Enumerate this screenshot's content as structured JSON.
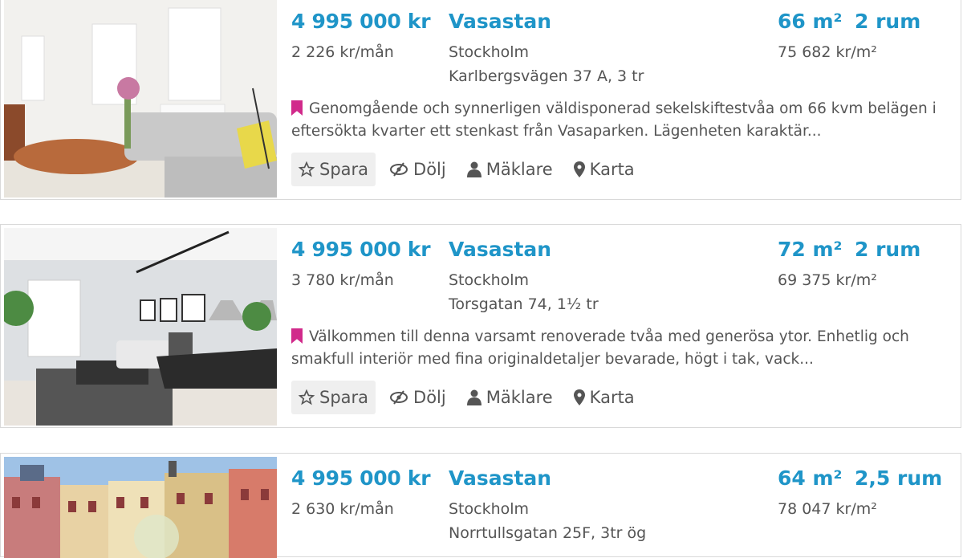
{
  "listings": [
    {
      "price": "4 995 000 kr",
      "area": "Vasastan",
      "sqm": "66 m²",
      "rooms": "2 rum",
      "fee": "2 226 kr/mån",
      "city": "Stockholm",
      "address": "Karlbergsvägen 37 A, 3 tr",
      "price_per_sqm": "75 682 kr/m²",
      "description": "Genomgående och synnerligen väldisponerad sekelskiftestvåa om 66 kvm belägen i eftersökta kvarter ett stenkast från Vasaparken. Lägenheten karaktär..."
    },
    {
      "price": "4 995 000 kr",
      "area": "Vasastan",
      "sqm": "72 m²",
      "rooms": "2 rum",
      "fee": "3 780 kr/mån",
      "city": "Stockholm",
      "address": "Torsgatan 74, 1½ tr",
      "price_per_sqm": "69 375 kr/m²",
      "description": "Välkommen till denna varsamt renoverade tvåa med generösa ytor. Enhetlig och smakfull interiör med fina originaldetaljer bevarade, högt i tak, vack..."
    },
    {
      "price": "4 995 000 kr",
      "area": "Vasastan",
      "sqm": "64 m²",
      "rooms": "2,5 rum",
      "fee": "2 630 kr/mån",
      "city": "Stockholm",
      "address": "Norrtullsgatan 25F, 3tr ög",
      "price_per_sqm": "78 047 kr/m²"
    }
  ],
  "actions": {
    "save": "Spara",
    "hide": "Dölj",
    "broker": "Mäklare",
    "map": "Karta"
  },
  "icons": {
    "save": "star-outline-icon",
    "hide": "eye-slash-icon",
    "broker": "user-icon",
    "map": "map-marker-icon",
    "description": "bookmark-icon"
  },
  "colors": {
    "accent": "#1f95c8",
    "bookmark": "#d12a8b",
    "text": "#555555",
    "save_button_bg": "#efefef"
  }
}
